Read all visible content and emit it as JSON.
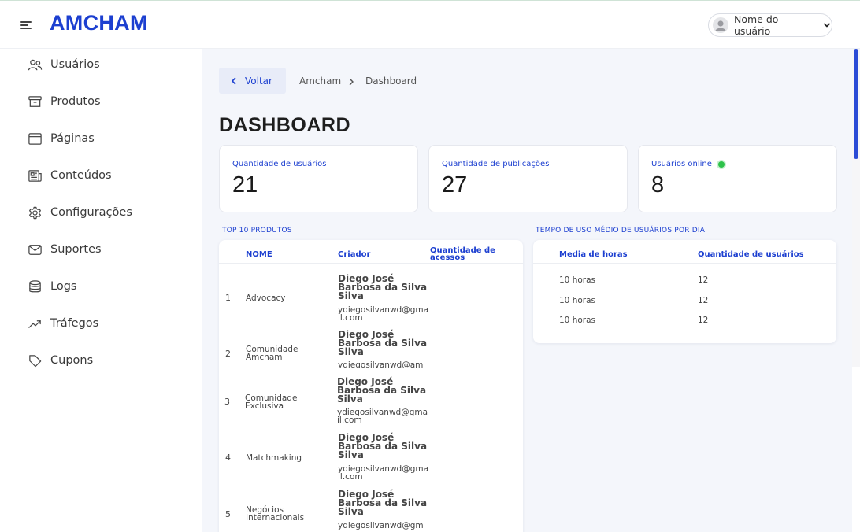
{
  "header": {
    "logo": "AMCHAM",
    "user_name": "Nome do usuário"
  },
  "sidebar": {
    "items": [
      {
        "label": "Usuários",
        "icon": "users-icon"
      },
      {
        "label": "Produtos",
        "icon": "archive-icon"
      },
      {
        "label": "Páginas",
        "icon": "browser-window-icon"
      },
      {
        "label": "Conteúdos",
        "icon": "newspaper-icon"
      },
      {
        "label": "Configurações",
        "icon": "gear-icon"
      },
      {
        "label": "Suportes",
        "icon": "envelope-icon"
      },
      {
        "label": "Logs",
        "icon": "database-icon"
      },
      {
        "label": "Tráfegos",
        "icon": "trending-up-icon"
      },
      {
        "label": "Cupons",
        "icon": "tag-icon"
      }
    ]
  },
  "breadcrumb": {
    "back_label": "Voltar",
    "items": [
      "Amcham",
      "Dashboard"
    ]
  },
  "page_title": "DASHBOARD",
  "stats": [
    {
      "label": "Quantidade de usuários",
      "value": "21"
    },
    {
      "label": "Quantidade de publicações",
      "value": "27"
    },
    {
      "label": "Usuários online",
      "value": "8"
    }
  ],
  "top_products": {
    "title": "TOP 10 PRODUTOS",
    "columns": [
      "NOME",
      "Criador",
      "Quantidade de acessos"
    ],
    "rows": [
      {
        "index": "1",
        "name": "Advocacy",
        "creator": "Diego José Barbosa da Silva Silva",
        "email": "ydiegosilvanwd@gmail.com"
      },
      {
        "index": "2",
        "name": "Comunidade Amcham",
        "creator": "Diego José Barbosa da Silva Silva",
        "email": "ydiegosilvanwd@am"
      },
      {
        "index": "3",
        "name": "Comunidade Exclusiva",
        "creator": "Diego José Barbosa da Silva Silva",
        "email": "ydiegosilvanwd@gmail.com"
      },
      {
        "index": "4",
        "name": "Matchmaking",
        "creator": "Diego José Barbosa da Silva Silva",
        "email": "ydiegosilvanwd@gmail.com"
      },
      {
        "index": "5",
        "name": "Negócios Internacionais",
        "creator": "Diego José Barbosa da Silva Silva",
        "email": "ydiegosilvanwd@gm"
      }
    ]
  },
  "usage_time": {
    "title": "TEMPO DE USO MÉDIO DE USUÁRIOS POR DIA",
    "columns": [
      "Media de horas",
      "Quantidade de usuários"
    ],
    "rows": [
      {
        "hours": "10 horas",
        "users": "12"
      },
      {
        "hours": "10 horas",
        "users": "12"
      },
      {
        "hours": "10 horas",
        "users": "12"
      }
    ]
  },
  "colors": {
    "accent": "#1c3fd0",
    "online": "#2ec24a",
    "background": "#f4f6fb"
  }
}
